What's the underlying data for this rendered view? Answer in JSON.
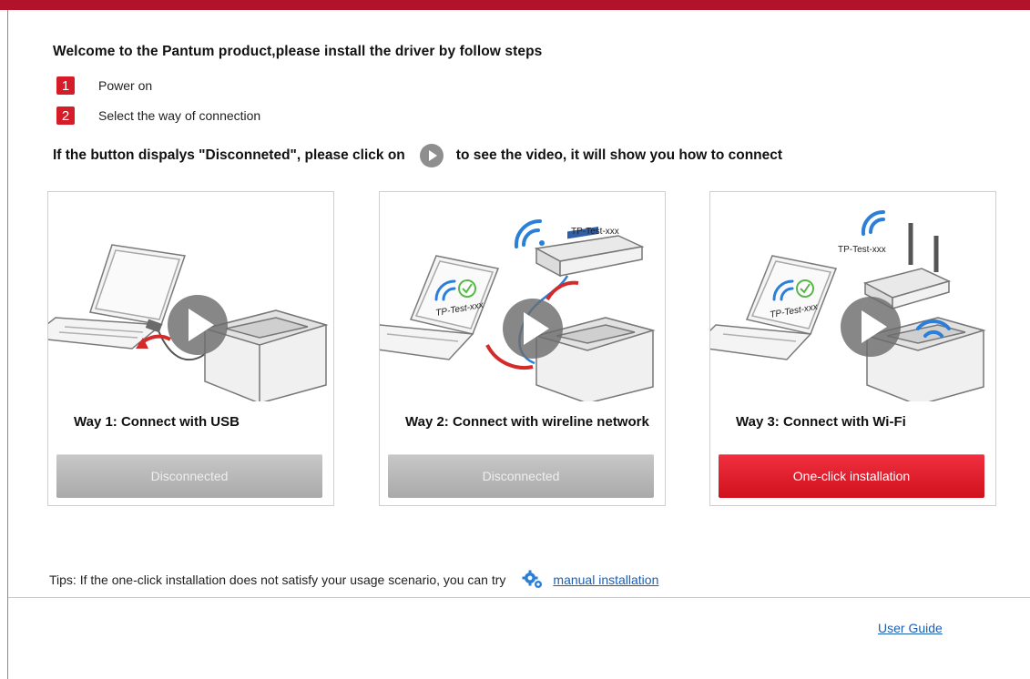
{
  "header": {
    "welcome": "Welcome to the Pantum product,please install the driver by follow steps",
    "steps": [
      {
        "number": "1",
        "label": "Power on"
      },
      {
        "number": "2",
        "label": "Select the way of connection"
      }
    ],
    "hint_before": "If the button dispalys \"Disconneted\", please click on",
    "hint_after": "to see the video, it will show you how to connect"
  },
  "cards": [
    {
      "title": "Way 1: Connect with USB",
      "button": "Disconnected",
      "button_state": "disconnected",
      "illustration_labels": []
    },
    {
      "title": "Way 2: Connect with wireline network",
      "button": "Disconnected",
      "button_state": "disconnected",
      "illustration_labels": [
        "TP-Test-xxx",
        "TP-Test-xxx"
      ]
    },
    {
      "title": "Way 3: Connect with Wi-Fi",
      "button": "One-click installation",
      "button_state": "active",
      "illustration_labels": [
        "TP-Test-xxx",
        "TP-Test-xxx"
      ]
    }
  ],
  "footer": {
    "tips": "Tips: If the one-click installation does not satisfy your usage scenario, you can try",
    "manual_link": "manual installation",
    "user_guide": "User Guide"
  },
  "icons": {
    "step_badge": "number-badge-icon",
    "play": "play-video-icon",
    "gear": "gear-icon",
    "wifi": "wifi-icon",
    "check": "checkmark-icon"
  },
  "colors": {
    "accent": "#d51d2a",
    "top_bar": "#b3132a",
    "disconnected_button": "#b5b5b5",
    "active_button": "#e31b2a",
    "link": "#1a5fb4",
    "wifi": "#2b7fd8"
  }
}
